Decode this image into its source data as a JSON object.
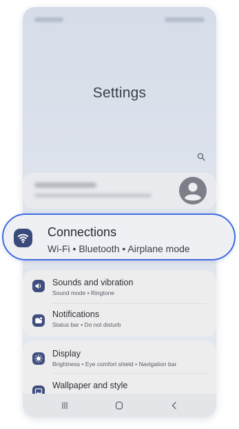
{
  "header": {
    "title": "Settings"
  },
  "icons": {
    "search": "search-icon",
    "avatar": "person-avatar-icon",
    "connections": "wifi-icon",
    "sounds": "volume-icon",
    "notifications": "notification-icon",
    "display": "brightness-icon",
    "wallpaper": "image-icon",
    "nav_recents": "recents-icon",
    "nav_home": "home-icon",
    "nav_back": "back-icon"
  },
  "colors": {
    "accent_outline": "#3d6be0",
    "icon_bg": "#3a4a7b"
  },
  "connections": {
    "title": "Connections",
    "subtitle": "Wi-Fi  •  Bluetooth  •  Airplane mode"
  },
  "items": [
    {
      "title": "Sounds and vibration",
      "subtitle": "Sound mode  •  Ringtone"
    },
    {
      "title": "Notifications",
      "subtitle": "Status bar  •  Do not disturb"
    },
    {
      "title": "Display",
      "subtitle": "Brightness  •  Eye comfort shield  •  Navigation bar"
    },
    {
      "title": "Wallpaper and style",
      "subtitle": ""
    }
  ]
}
